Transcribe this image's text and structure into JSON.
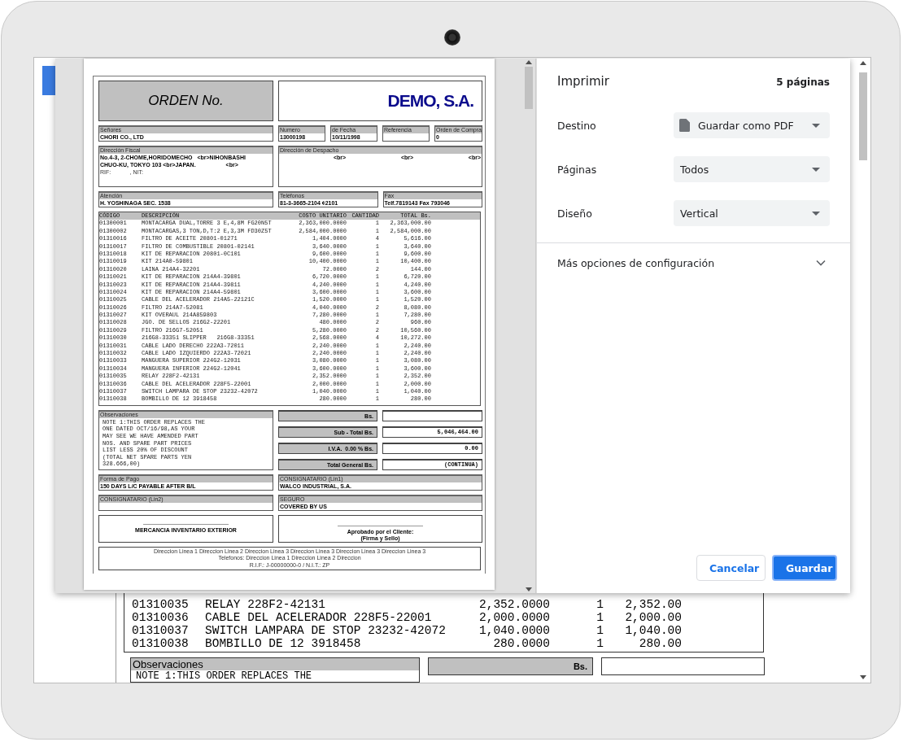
{
  "background_page": {
    "rows": [
      {
        "code": "01310035",
        "description": "RELAY 228F2-42131",
        "unit_cost": "2,352.0000",
        "quantity": "1",
        "total": "2,352.00"
      },
      {
        "code": "01310036",
        "description": "CABLE DEL ACELERADOR 228F5-22001",
        "unit_cost": "2,000.0000",
        "quantity": "1",
        "total": "2,000.00"
      },
      {
        "code": "01310037",
        "description": "SWITCH LAMPARA DE STOP 23232-42072",
        "unit_cost": "1,040.0000",
        "quantity": "1",
        "total": "1,040.00"
      },
      {
        "code": "01310038",
        "description": "BOMBILLO DE 12 3918458",
        "unit_cost": "280.0000",
        "quantity": "1",
        "total": "280.00"
      }
    ],
    "observaciones": {
      "label": "Observaciones",
      "text": "NOTE 1:THIS ORDER REPLACES THE"
    },
    "totals_label": "Bs."
  },
  "preview": {
    "document": {
      "title": "ORDEN No.",
      "company": "DEMO, S.A.",
      "customer": {
        "label": "Señores",
        "value": "CHORI CO., LTD"
      },
      "order_fields": [
        {
          "label": "Numero",
          "value": "13000198"
        },
        {
          "label": "de Fecha",
          "value": "10/11/1998"
        },
        {
          "label": "Referencia"
        },
        {
          "label": "Orden de Compra",
          "value": "0"
        }
      ],
      "fiscal_address": {
        "label": "Dirección Fiscal",
        "lines": [
          "No.4-3, 2-CHOME,HORIDOMECHO   <br>NIHONBASHI",
          "CHUO-KU, TOKYO 103 <br>JAPAN.                   <br>"
        ],
        "rif": "RIF:            , NIT:"
      },
      "shipping_address": {
        "label": "Dirección de Despacho",
        "parts": [
          "<br>",
          "<br>",
          "<br>"
        ]
      },
      "attention": {
        "label": "Atención",
        "value": "H. YOSHINAGA SEC. 1538"
      },
      "contacts": [
        {
          "label": "Teléfonos",
          "value": "81-3-3665-2104 ¢2101"
        },
        {
          "label": "Fax",
          "value": "Telf.7819143 Fax 793046"
        }
      ],
      "table": {
        "columns": [
          "CÓDIGO",
          "DESCRIPCIÓN",
          "COSTO UNITARIO",
          "CANTIDAD",
          "TOTAL Bs."
        ],
        "rows": [
          [
            "01300001",
            "MONTACARGA DUAL,TORRE 3 E,4,8M FG20N5T",
            "2,363,000.0000",
            "1",
            "2,363,000.00"
          ],
          [
            "01300002",
            "MONTACARGAS,3 TON,D,T:2 E,3,3M FD30Z5T",
            "2,584,000.0000",
            "1",
            "2,584,000.00"
          ],
          [
            "01310016",
            "FILTRO DE ACEITE 20801-01271",
            "1,404.0000",
            "4",
            "5,616.00"
          ],
          [
            "01310017",
            "FILTRO DE COMBUSTIBLE 20801-02141",
            "3,640.0000",
            "1",
            "3,640.00"
          ],
          [
            "01310018",
            "KIT DE REPARACION 20801-0C101",
            "9,600.0000",
            "1",
            "9,600.00"
          ],
          [
            "01310019",
            "KIT 214A0-59801",
            "10,400.0000",
            "1",
            "10,400.00"
          ],
          [
            "01310020",
            "LAINA 214A4-32201",
            "72.0000",
            "2",
            "144.00"
          ],
          [
            "01310021",
            "KIT DE REPARACION 214A4-39801",
            "6,720.0000",
            "1",
            "6,720.00"
          ],
          [
            "01310023",
            "KIT DE REPARACION 214A4-39811",
            "4,240.0000",
            "1",
            "4,240.00"
          ],
          [
            "01310024",
            "KIT DE REPARACION 214A4-59801",
            "3,600.0000",
            "1",
            "3,600.00"
          ],
          [
            "01310025",
            "CABLE DEL ACELERADOR 214A5-22121C",
            "1,520.0000",
            "1",
            "1,520.00"
          ],
          [
            "01310026",
            "FILTRO 214A7-52081",
            "4,040.0000",
            "2",
            "8,080.00"
          ],
          [
            "01310027",
            "KIT OVERAUL 214A859803",
            "7,280.0000",
            "1",
            "7,280.00"
          ],
          [
            "01310028",
            "JGO. DE SELLOS 216G2-22201",
            "480.0000",
            "2",
            "960.00"
          ],
          [
            "01310029",
            "FILTRO 216G7-52051",
            "5,280.0000",
            "2",
            "10,560.00"
          ],
          [
            "01310030",
            "216G8-33351 SLIPPER   216G8-33351",
            "2,568.0000",
            "4",
            "10,272.00"
          ],
          [
            "01310031",
            "CABLE LADO DERECHO 222A3-72011",
            "2,240.0000",
            "1",
            "2,240.00"
          ],
          [
            "01310032",
            "CABLE LADO IZQUIERDO 222A3-72021",
            "2,240.0000",
            "1",
            "2,240.00"
          ],
          [
            "01310033",
            "MANGUERA SUPERIOR 224G2-12031",
            "3,080.0000",
            "1",
            "3,080.00"
          ],
          [
            "01310034",
            "MANGUERA INFERIOR 224G2-12041",
            "3,600.0000",
            "1",
            "3,600.00"
          ],
          [
            "01310035",
            "RELAY 228F2-42131",
            "2,352.0000",
            "1",
            "2,352.00"
          ],
          [
            "01310036",
            "CABLE DEL ACELERADOR 228F5-22001",
            "2,000.0000",
            "1",
            "2,000.00"
          ],
          [
            "01310037",
            "SWITCH LAMPARA DE STOP 23232-42072",
            "1,040.0000",
            "1",
            "1,040.00"
          ],
          [
            "01310038",
            "BOMBILLO DE 12 3918458",
            "280.0000",
            "1",
            "280.00"
          ]
        ]
      },
      "observaciones": {
        "label": "Observaciones",
        "text": "NOTE 1:THIS ORDER REPLACES THE\nONE DATED OCT/16/98,AS YOUR\nMAY SEE WE HAVE AMENDED PART\nNOS. AND SPARE PART PRICES\nLIST LESS 20% OF DISCOUNT\n(TOTAL NET SPARE PARTS YEN\n328.666,00)"
      },
      "totals": [
        {
          "label": "Bs."
        },
        {
          "label": "Sub - Total Bs.",
          "value": "5,046,464.00"
        },
        {
          "label": "I.V.A.  0.00 % Bs.",
          "value": "0.00"
        },
        {
          "label": "Total General Bs.",
          "value": "(CONTINUA)"
        }
      ],
      "terms": [
        {
          "label": "Forma de Pago",
          "value": "150 DAYS L/C PAYABLE AFTER B/L"
        },
        {
          "label": "CONSIGNATARIO (Lin1)",
          "value": "WALCO INDUSTRIAL, S.A."
        },
        {
          "label": "CONSIGNATARIO (Lin2)"
        },
        {
          "label": "SEGURO",
          "value": "COVERED BY US"
        }
      ],
      "signatures": [
        {
          "lines": [
            "MERCANCIA INVENTARIO EXTERIOR"
          ]
        },
        {
          "lines": [
            "Aprobado por el Cliente:",
            "(Firma y Sello)"
          ]
        }
      ],
      "footer": [
        "Direccion Linea 1 Direccion Linea 2 Direccion Linea 3 Direccion Linea 3 Direccion Linea 3 Direccion Linea 3",
        "Telefonos: Direccion Linea 1 Direccion Linea 2 Direccion",
        "R.I.F.: J-00000000-0 / N.I.T.: ZP"
      ]
    }
  },
  "print_panel": {
    "title": "Imprimir",
    "page_count": "5 páginas",
    "settings": [
      {
        "label": "Destino",
        "value": "Guardar como PDF",
        "kind": "file-select"
      },
      {
        "label": "Páginas",
        "value": "Todos",
        "kind": "select"
      },
      {
        "label": "Diseño",
        "value": "Vertical",
        "kind": "select"
      }
    ],
    "more_options": {
      "label": "Más opciones de configuración",
      "expanded": false
    },
    "buttons": [
      {
        "label": "Cancelar",
        "kind": "secondary"
      },
      {
        "label": "Guardar",
        "kind": "primary"
      }
    ]
  }
}
